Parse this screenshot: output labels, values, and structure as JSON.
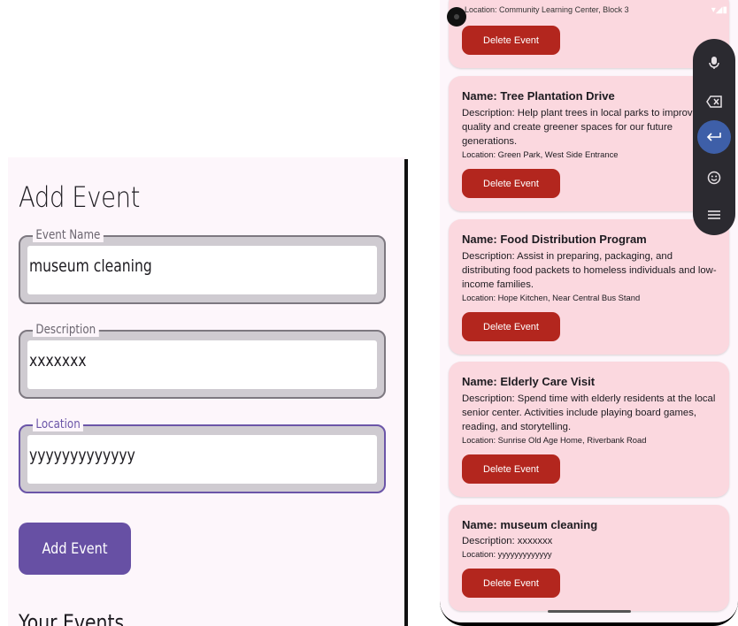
{
  "left_panel": {
    "title": "Add Event",
    "fields": {
      "event_name": {
        "label": "Event Name",
        "value": "museum cleaning"
      },
      "description": {
        "label": "Description",
        "value": "xxxxxxx"
      },
      "location": {
        "label": "Location",
        "value": "yyyyyyyyyyyyy"
      }
    },
    "add_button": "Add Event",
    "section_title": "Your Events"
  },
  "phone": {
    "partial_location": "Location: Community Learning Center, Block 3",
    "events": [
      {
        "name": "",
        "description": "",
        "location": "",
        "delete": "Delete Event"
      },
      {
        "name": "Name: Tree Plantation Drive",
        "description": "Description: Help plant trees in local parks to improve air quality and create greener spaces for our future generations.",
        "location": "Location: Green Park, West Side Entrance",
        "delete": "Delete Event"
      },
      {
        "name": "Name: Food Distribution Program",
        "description": "Description: Assist in preparing, packaging, and distributing food packets to homeless individuals and low-income families.",
        "location": "Location: Hope Kitchen, Near Central Bus Stand",
        "delete": "Delete Event"
      },
      {
        "name": "Name: Elderly Care Visit",
        "description": "Description: Spend time with elderly residents at the local senior center. Activities include playing board games, reading, and storytelling.",
        "location": "Location: Sunrise Old Age Home, Riverbank Road",
        "delete": "Delete Event"
      },
      {
        "name": "Name: museum cleaning",
        "description": "Description: xxxxxxx",
        "location": "Location: yyyyyyyyyyyyy",
        "delete": "Delete Event"
      }
    ],
    "keyboard_toolbar": [
      "microphone-icon",
      "backspace-icon",
      "enter-icon",
      "emoji-icon",
      "menu-icon"
    ]
  }
}
